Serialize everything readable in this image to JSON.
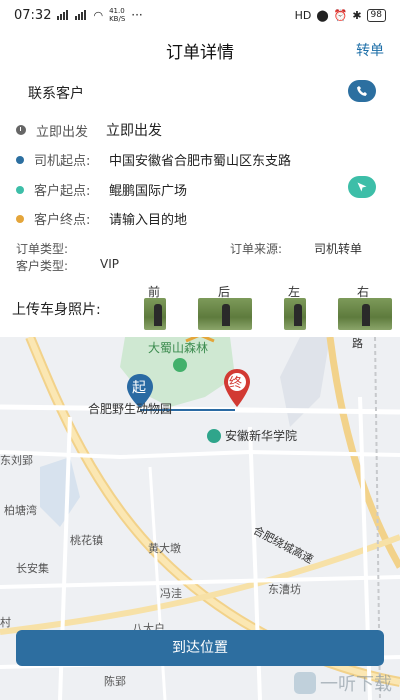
{
  "status_bar": {
    "time": "07:32",
    "net_speed": "41.0",
    "net_unit": "KB/S",
    "hd": "HD",
    "battery": "98",
    "more": "···"
  },
  "header": {
    "title": "订单详情",
    "action": "转单"
  },
  "contact": {
    "label": "联系客户"
  },
  "rows": [
    {
      "label": "立即出发",
      "value": "立即出发",
      "color": "#666666"
    },
    {
      "label": "司机起点:",
      "value": "中国安徽省合肥市蜀山区东支路",
      "color": "#2c6fa0"
    },
    {
      "label": "客户起点:",
      "value": "鲲鹏国际广场",
      "color": "#3dbea8"
    },
    {
      "label": "客户终点:",
      "value": "请输入目的地",
      "color": "#e4a53a"
    }
  ],
  "meta": {
    "order_type_label": "订单类型:",
    "order_source_label": "订单来源:",
    "order_source_value": "司机转单",
    "customer_type_label": "客户类型:",
    "customer_type_value": "VIP"
  },
  "photos": {
    "label": "上传车身照片:",
    "headers": [
      "前",
      "后",
      "左",
      "右"
    ]
  },
  "map": {
    "start_marker": "起",
    "end_marker": "终",
    "labels": {
      "zoo": "合肥野生动物园",
      "college": "安徽新华学院",
      "forest": "大蜀山森林",
      "east_pay": "东刘郢",
      "baiyangwan": "柏塘湾",
      "taohua": "桃花镇",
      "huangda": "黄大墩",
      "changan": "长安集",
      "fengjie": "冯洼",
      "dongcao": "东漕坊",
      "bada": "八大户",
      "chenying": "陈郢",
      "cun": "村",
      "expressway": "合肥绕城高速",
      "road_top": "路"
    }
  },
  "button": {
    "arrive": "到达位置"
  },
  "watermark": {
    "text": "一听下载"
  },
  "colors": {
    "accent": "#2c6fa0",
    "teal": "#3dbea8",
    "start_pin": "#2a6aa3",
    "end_pin": "#d23a33"
  }
}
